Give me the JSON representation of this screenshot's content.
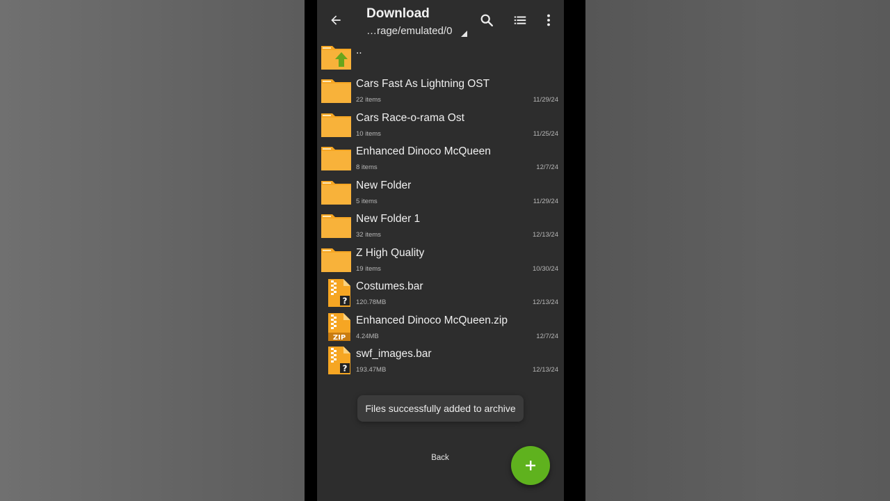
{
  "toolbar": {
    "title": "Download",
    "path": "…rage/emulated/0",
    "icons": [
      "back-arrow-icon",
      "search-icon",
      "list-view-icon",
      "more-vert-icon"
    ]
  },
  "files": [
    {
      "name": "..",
      "meta": "",
      "date": "",
      "icon": "folder-up"
    },
    {
      "name": "Cars Fast As Lightning OST",
      "meta": "22 items",
      "date": "11/29/24",
      "icon": "folder"
    },
    {
      "name": "Cars Race-o-rama Ost",
      "meta": "10 items",
      "date": "11/25/24",
      "icon": "folder"
    },
    {
      "name": "Enhanced Dinoco McQueen",
      "meta": "8 items",
      "date": "12/7/24",
      "icon": "folder"
    },
    {
      "name": "New Folder",
      "meta": "5 items",
      "date": "11/29/24",
      "icon": "folder"
    },
    {
      "name": "New Folder 1",
      "meta": "32 items",
      "date": "12/13/24",
      "icon": "folder"
    },
    {
      "name": "Z High Quality",
      "meta": "19 items",
      "date": "10/30/24",
      "icon": "folder"
    },
    {
      "name": "Costumes.bar",
      "meta": "120.78MB",
      "date": "12/13/24",
      "icon": "archive-unknown"
    },
    {
      "name": "Enhanced Dinoco McQueen.zip",
      "meta": "4.24MB",
      "date": "12/7/24",
      "icon": "archive-zip"
    },
    {
      "name": "swf_images.bar",
      "meta": "193.47MB",
      "date": "12/13/24",
      "icon": "archive-unknown"
    }
  ],
  "archive_icon_labels": {
    "zip": "ZIP",
    "unknown": "?"
  },
  "toast": {
    "message": "Files successfully added to archive"
  },
  "bottom": {
    "back_label": "Back",
    "fab_label": "+"
  },
  "colors": {
    "background": "#2d2d2d",
    "folder": "#f6a623",
    "folder_tab": "#f8c35a",
    "up_arrow": "#6aa51c",
    "fab": "#5fb21e",
    "text": "#f0f0f0",
    "subtext": "#b8b8b8"
  }
}
